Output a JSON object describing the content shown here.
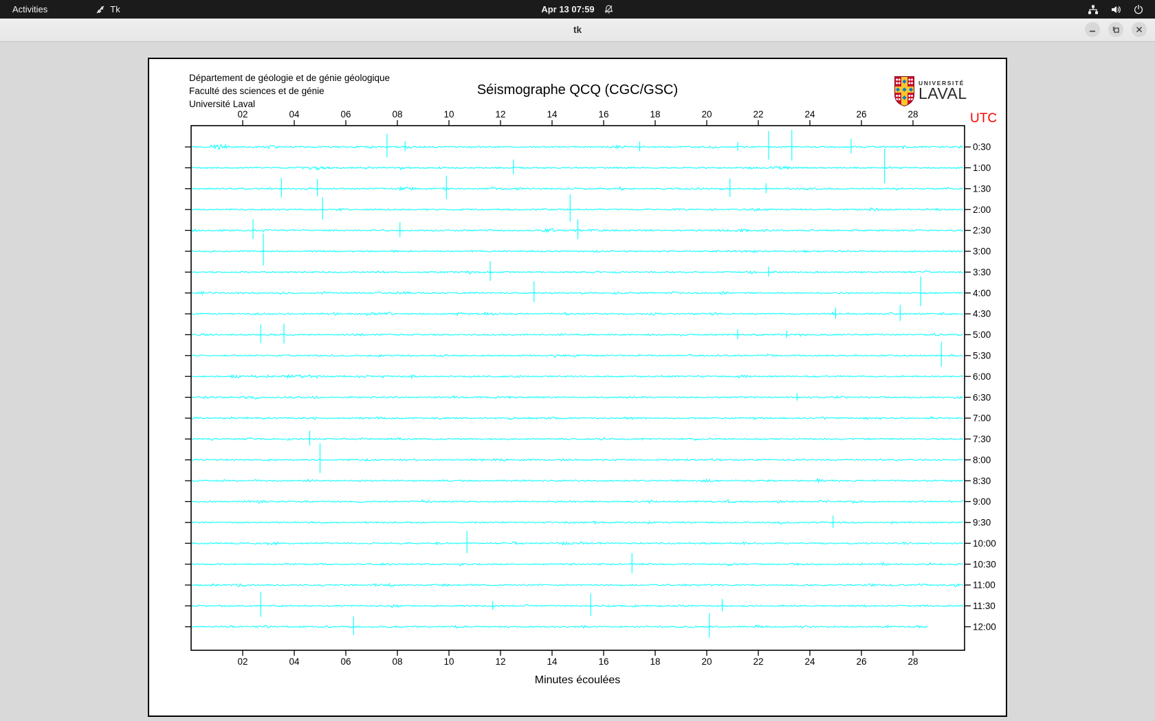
{
  "top_bar": {
    "activities": "Activities",
    "app_name": "Tk",
    "clock": "Apr 13 07:59",
    "icons": [
      "tk-feather",
      "notifications-disabled",
      "wired-network",
      "volume",
      "power"
    ]
  },
  "window": {
    "title": "tk",
    "controls": [
      "minimize",
      "maximize",
      "close"
    ]
  },
  "canvas": {
    "header_lines": [
      "Département de géologie et de génie géologique",
      "Faculté des sciences et de génie",
      "Université Laval"
    ],
    "title": "Séismographe QCQ (CGC/GSC)",
    "logo": {
      "line1": "UNIVERSITÉ",
      "line2": "LAVAL"
    },
    "utc_label": "UTC",
    "xlabel": "Minutes écoulées",
    "colors": {
      "trace": "#00ffff",
      "utc": "#ff0000",
      "axis": "#000000",
      "logo_red": "#c8102e",
      "logo_gold": "#ffc72c",
      "logo_blue": "#0f83c4"
    },
    "plot": {
      "minutes_span": 30,
      "x_tick_minutes": [
        2,
        4,
        6,
        8,
        10,
        12,
        14,
        16,
        18,
        20,
        22,
        24,
        26,
        28
      ],
      "x_ticks": [
        "02",
        "04",
        "06",
        "08",
        "10",
        "12",
        "14",
        "16",
        "18",
        "20",
        "22",
        "24",
        "26",
        "28"
      ]
    },
    "traces": [
      {
        "label": "0:30",
        "spikes": [
          [
            7.6,
            19
          ],
          [
            8.3,
            8
          ],
          [
            17.4,
            8
          ],
          [
            21.2,
            7
          ],
          [
            22.4,
            23
          ],
          [
            23.3,
            25
          ],
          [
            25.6,
            12
          ]
        ],
        "bursts": [
          [
            0.7,
            1.5,
            3.5
          ],
          [
            16.2,
            18.3,
            1.3
          ]
        ]
      },
      {
        "label": "1:00",
        "spikes": [
          [
            12.5,
            12
          ],
          [
            26.9,
            28
          ]
        ],
        "bursts": [
          [
            4.6,
            5.2,
            2.8
          ],
          [
            22.6,
            23.2,
            2.2
          ]
        ]
      },
      {
        "label": "1:30",
        "spikes": [
          [
            3.5,
            16
          ],
          [
            4.9,
            14
          ],
          [
            9.9,
            19
          ],
          [
            20.9,
            15
          ],
          [
            22.3,
            8
          ]
        ],
        "bursts": [
          [
            8.0,
            8.6,
            2.4
          ]
        ]
      },
      {
        "label": "2:00",
        "spikes": [
          [
            5.1,
            18
          ],
          [
            14.7,
            22
          ]
        ],
        "bursts": []
      },
      {
        "label": "2:30",
        "spikes": [
          [
            2.4,
            16
          ],
          [
            8.1,
            12
          ],
          [
            15.0,
            16
          ]
        ],
        "bursts": [
          [
            13.6,
            14.2,
            2.6
          ],
          [
            21.1,
            21.6,
            2.0
          ]
        ]
      },
      {
        "label": "3:00",
        "spikes": [
          [
            2.8,
            26
          ]
        ],
        "bursts": []
      },
      {
        "label": "3:30",
        "spikes": [
          [
            11.6,
            16
          ],
          [
            22.4,
            8
          ]
        ],
        "bursts": [
          [
            21.4,
            22.0,
            2.4
          ]
        ]
      },
      {
        "label": "4:00",
        "spikes": [
          [
            13.3,
            17
          ],
          [
            28.3,
            24
          ]
        ],
        "bursts": []
      },
      {
        "label": "4:30",
        "spikes": [
          [
            25.0,
            9
          ],
          [
            27.5,
            13
          ]
        ],
        "bursts": [
          [
            7.3,
            7.9,
            2.4
          ]
        ]
      },
      {
        "label": "5:00",
        "spikes": [
          [
            2.7,
            15
          ],
          [
            3.6,
            16
          ],
          [
            21.2,
            8
          ],
          [
            23.1,
            6
          ]
        ],
        "bursts": [
          [
            6.2,
            6.7,
            1.8
          ]
        ]
      },
      {
        "label": "5:30",
        "spikes": [
          [
            29.1,
            20
          ]
        ],
        "bursts": []
      },
      {
        "label": "6:00",
        "spikes": [],
        "bursts": [
          [
            1.5,
            1.9,
            2.2
          ],
          [
            3.6,
            4.1,
            2.6
          ],
          [
            4.5,
            4.9,
            2.4
          ],
          [
            6.5,
            6.9,
            2.2
          ]
        ]
      },
      {
        "label": "6:30",
        "spikes": [
          [
            23.5,
            6
          ]
        ],
        "bursts": [
          [
            2.1,
            2.6,
            2.6
          ]
        ]
      },
      {
        "label": "7:00",
        "spikes": [],
        "bursts": []
      },
      {
        "label": "7:30",
        "spikes": [
          [
            4.6,
            12
          ]
        ],
        "bursts": []
      },
      {
        "label": "8:00",
        "spikes": [
          [
            5.0,
            24
          ]
        ],
        "bursts": [
          [
            11.7,
            12.2,
            2.0
          ]
        ]
      },
      {
        "label": "8:30",
        "spikes": [],
        "bursts": []
      },
      {
        "label": "9:00",
        "spikes": [],
        "bursts": []
      },
      {
        "label": "9:30",
        "spikes": [
          [
            24.9,
            10
          ]
        ],
        "bursts": []
      },
      {
        "label": "10:00",
        "spikes": [
          [
            10.7,
            18
          ]
        ],
        "bursts": []
      },
      {
        "label": "10:30",
        "spikes": [
          [
            17.1,
            16
          ]
        ],
        "bursts": []
      },
      {
        "label": "11:00",
        "spikes": [],
        "bursts": []
      },
      {
        "label": "11:30",
        "spikes": [
          [
            2.7,
            20
          ],
          [
            11.7,
            7
          ],
          [
            15.5,
            18
          ],
          [
            20.6,
            10
          ]
        ],
        "bursts": []
      },
      {
        "label": "12:00",
        "spikes": [
          [
            6.3,
            15
          ],
          [
            20.1,
            20
          ]
        ],
        "bursts": [],
        "end": 28.6
      }
    ]
  }
}
